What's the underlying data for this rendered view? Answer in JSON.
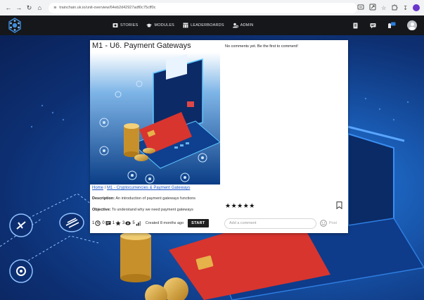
{
  "browser": {
    "url": "trainchain.uk.io/unit-overview/64eb2d42927adf0c75cff0c"
  },
  "header": {
    "nav": [
      {
        "label": "STORIES",
        "icon": "stories-icon"
      },
      {
        "label": "MODULES",
        "icon": "graduation-cap-icon"
      },
      {
        "label": "LEADERBOARDS",
        "icon": "leaderboard-icon"
      },
      {
        "label": "ADMIN",
        "icon": "admin-icon"
      }
    ]
  },
  "unit": {
    "title": "M1 - U6. Payment Gateways",
    "breadcrumb": {
      "home": "Home",
      "separator": "/",
      "module": "M1 - Cryptocurrencies & Payment Gateways"
    },
    "description_label": "Description:",
    "description": "An introduction of payment gateways functions",
    "objective_label": "Objective:",
    "objective": "To understand why we need payment gateways",
    "stats": {
      "time": "1",
      "comments": "0",
      "ratings": "1",
      "views": "3",
      "level": "5"
    },
    "created": "Created 8 months ago",
    "start_label": "START"
  },
  "comments": {
    "empty_text": "No comments yet. Be the first to comment!",
    "rating_stars": "★★★★★",
    "placeholder": "Add a comment",
    "post_label": "Post"
  },
  "colors": {
    "header_bg": "#15171b",
    "background_blue": "#1450a8",
    "link": "#1a56c9",
    "start_button": "#1f1f1f"
  }
}
